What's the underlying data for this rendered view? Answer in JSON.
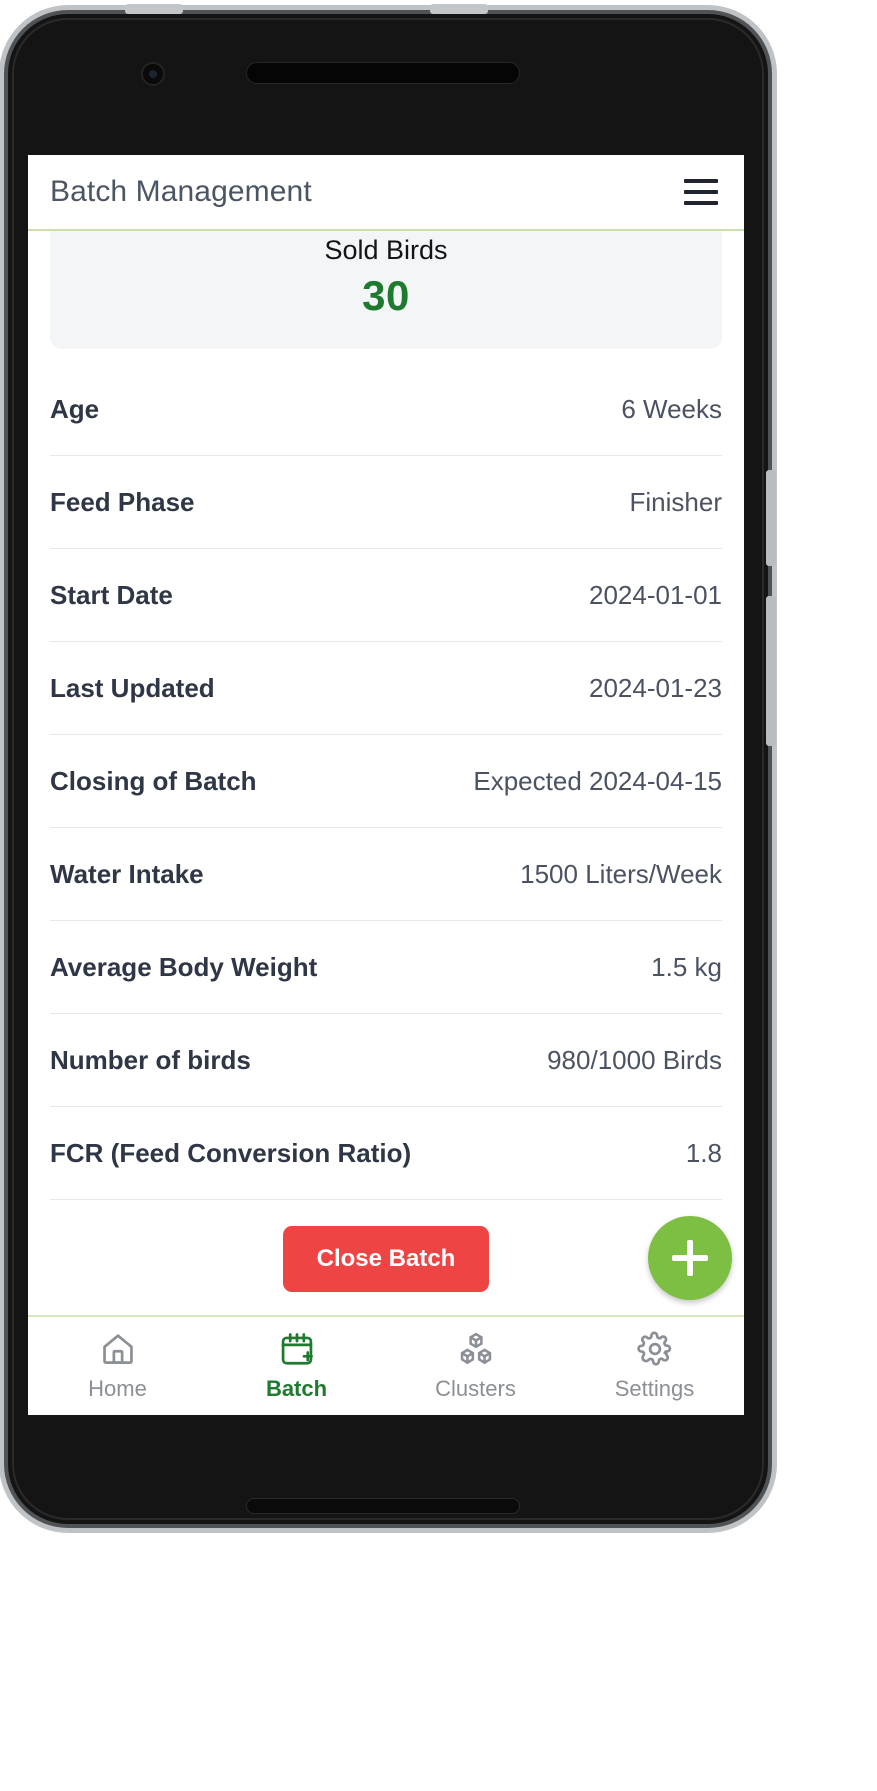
{
  "app": {
    "title": "Batch Management",
    "menu_icon": "hamburger-menu-icon"
  },
  "summary_card": {
    "label": "Sold Birds",
    "value": "30",
    "value_color": "#1e7a2e"
  },
  "detail_rows": [
    {
      "label": "Age",
      "value": "6 Weeks"
    },
    {
      "label": "Feed Phase",
      "value": "Finisher"
    },
    {
      "label": "Start Date",
      "value": "2024-01-01"
    },
    {
      "label": "Last Updated",
      "value": "2024-01-23"
    },
    {
      "label": "Closing of Batch",
      "value": "Expected 2024-04-15"
    },
    {
      "label": "Water Intake",
      "value": "1500 Liters/Week"
    },
    {
      "label": "Average Body Weight",
      "value": "1.5 kg"
    },
    {
      "label": "Number of birds",
      "value": "980/1000 Birds"
    },
    {
      "label": "FCR (Feed Conversion Ratio)",
      "value": "1.8"
    }
  ],
  "actions": {
    "close_batch_label": "Close Batch",
    "close_batch_color": "#ef4444",
    "fab_icon": "plus-icon",
    "fab_color": "#7cbf42"
  },
  "bottom_nav": {
    "active_color": "#1e7a2e",
    "inactive_color": "#8b8f96",
    "items": [
      {
        "label": "Home",
        "icon": "home-icon",
        "active": false
      },
      {
        "label": "Batch",
        "icon": "calendar-plus-icon",
        "active": true
      },
      {
        "label": "Clusters",
        "icon": "cubes-icon",
        "active": false
      },
      {
        "label": "Settings",
        "icon": "gear-icon",
        "active": false
      }
    ]
  }
}
